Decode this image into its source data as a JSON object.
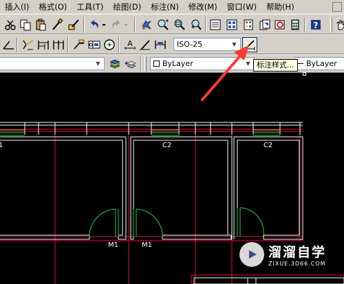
{
  "menu": {
    "items": [
      "插入(I)",
      "格式(O)",
      "工具(T)",
      "绘图(D)",
      "标注(N)",
      "修改(M)",
      "窗口(W)",
      "帮助(H)"
    ]
  },
  "toolbar2": {
    "dim_style_value": "ISO-25"
  },
  "toolbar3": {
    "color_value": "ByLayer",
    "linetype_value": "ByLayer"
  },
  "tooltip": {
    "text": "标注样式..."
  },
  "drawing": {
    "window_tags": [
      "C2",
      "C2"
    ],
    "partial_tag": "1",
    "door_tags": [
      "M1",
      "M1"
    ]
  },
  "watermark": {
    "title": "溜溜自学",
    "url": "ZIXUE.3D66.COM"
  },
  "colors": {
    "ui_face": "#d4d0c8",
    "canvas": "#000000",
    "wall": "#ffffff",
    "axis": "#e0103a",
    "window": "#22cc44",
    "annotation_arrow": "#ff3b30"
  }
}
